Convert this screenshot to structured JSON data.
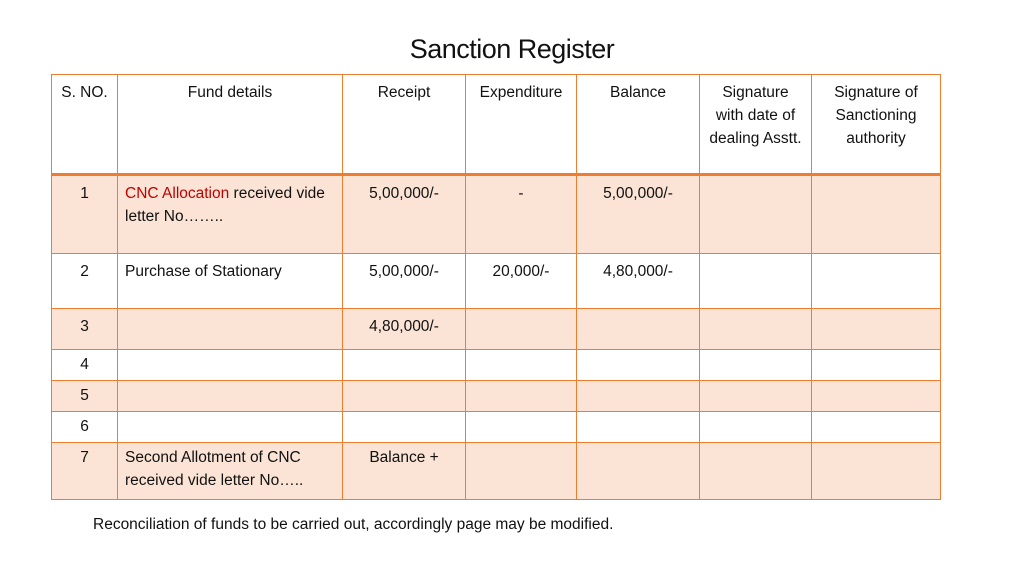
{
  "title": "Sanction Register",
  "columns": [
    "S. NO.",
    "Fund details",
    "Receipt",
    "Expenditure",
    "Balance",
    "Signature with date of dealing Asstt.",
    "Signature of Sanctioning authority"
  ],
  "rows": [
    {
      "sno": "1",
      "fund_highlight": "CNC Allocation",
      "fund": " received vide letter No……..",
      "receipt": "5,00,000/-",
      "expenditure": "-",
      "balance": "5,00,000/-",
      "sig_dealing": "",
      "sig_authority": ""
    },
    {
      "sno": "2",
      "fund_highlight": "",
      "fund": "Purchase of Stationary",
      "receipt": "5,00,000/-",
      "expenditure": "20,000/-",
      "balance": "4,80,000/-",
      "sig_dealing": "",
      "sig_authority": ""
    },
    {
      "sno": "3",
      "fund_highlight": "",
      "fund": "",
      "receipt": "4,80,000/-",
      "expenditure": "",
      "balance": "",
      "sig_dealing": "",
      "sig_authority": ""
    },
    {
      "sno": "4",
      "fund_highlight": "",
      "fund": "",
      "receipt": "",
      "expenditure": "",
      "balance": "",
      "sig_dealing": "",
      "sig_authority": ""
    },
    {
      "sno": "5",
      "fund_highlight": "",
      "fund": "",
      "receipt": "",
      "expenditure": "",
      "balance": "",
      "sig_dealing": "",
      "sig_authority": ""
    },
    {
      "sno": "6",
      "fund_highlight": "",
      "fund": "",
      "receipt": "",
      "expenditure": "",
      "balance": "",
      "sig_dealing": "",
      "sig_authority": ""
    },
    {
      "sno": "7",
      "fund_highlight": "",
      "fund": "Second Allotment of CNC received vide letter No…..",
      "receipt": "Balance +",
      "expenditure": "",
      "balance": "",
      "sig_dealing": "",
      "sig_authority": ""
    }
  ],
  "note": "Reconciliation of funds to be carried out, accordingly page may be modified.",
  "colors": {
    "border": "#ed7d31",
    "band": "#fbe4d5",
    "highlight": "#c00000"
  }
}
